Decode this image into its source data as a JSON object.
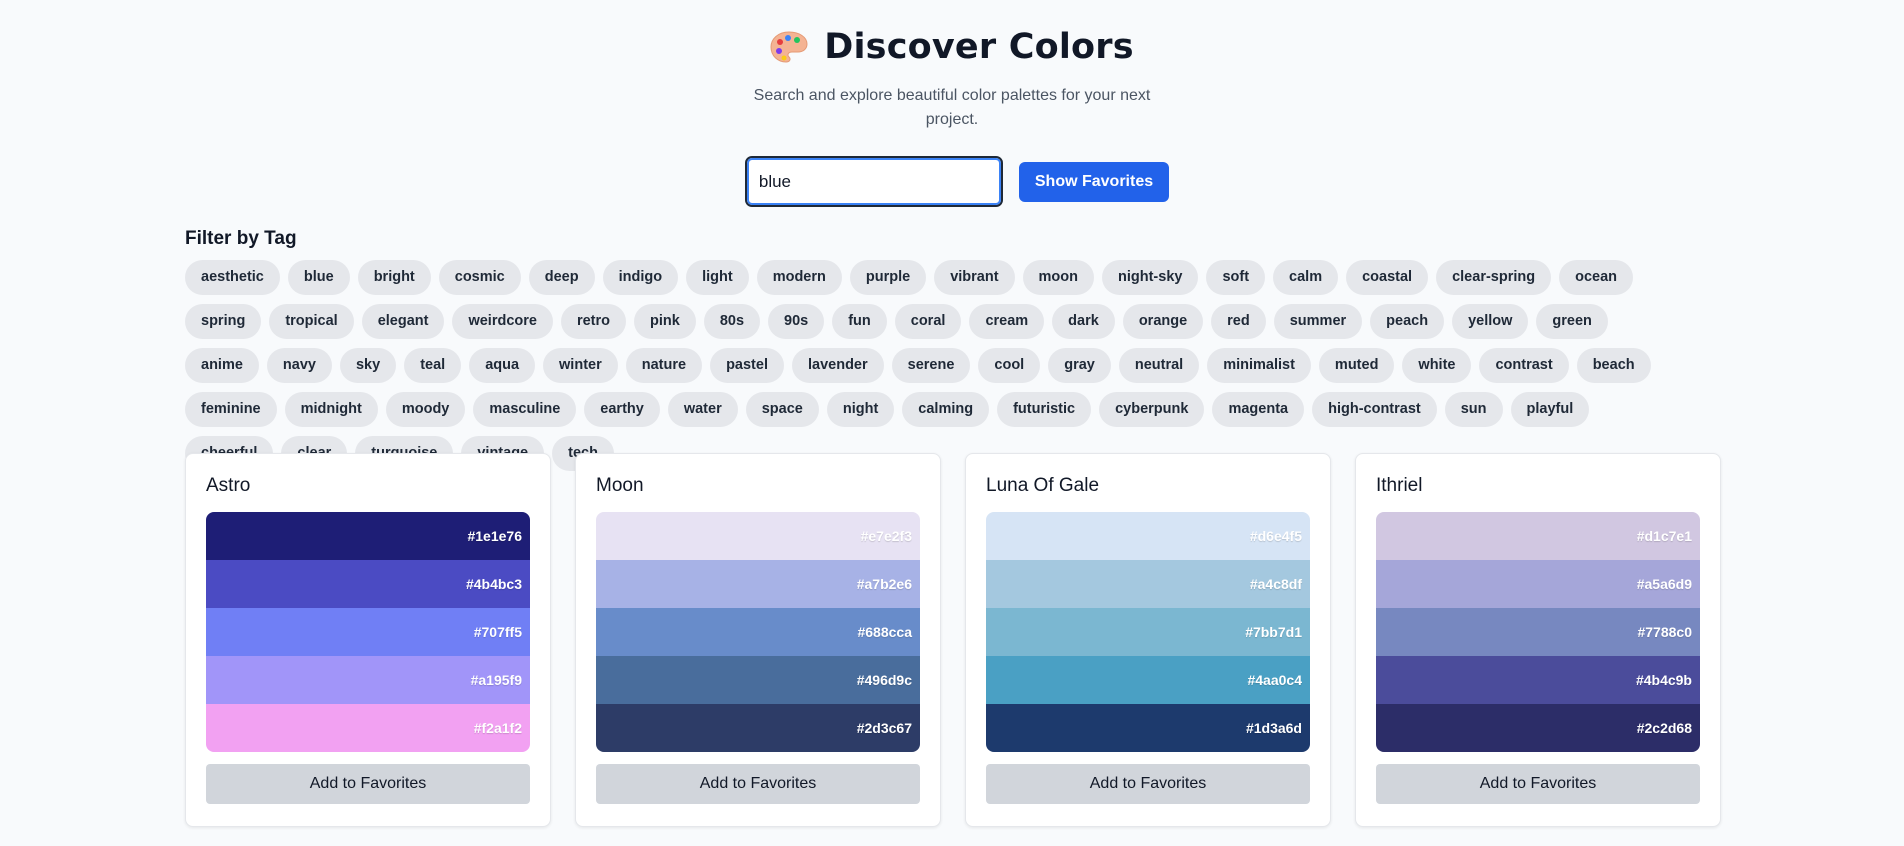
{
  "header": {
    "title": "Discover Colors",
    "subtitle": "Search and explore beautiful color palettes for your next project."
  },
  "search": {
    "value": "blue"
  },
  "favorites_button": "Show Favorites",
  "filter": {
    "title": "Filter by Tag",
    "tags": [
      "aesthetic",
      "blue",
      "bright",
      "cosmic",
      "deep",
      "indigo",
      "light",
      "modern",
      "purple",
      "vibrant",
      "moon",
      "night-sky",
      "soft",
      "calm",
      "coastal",
      "clear-spring",
      "ocean",
      "spring",
      "tropical",
      "elegant",
      "weirdcore",
      "retro",
      "pink",
      "80s",
      "90s",
      "fun",
      "coral",
      "cream",
      "dark",
      "orange",
      "red",
      "summer",
      "peach",
      "yellow",
      "green",
      "anime",
      "navy",
      "sky",
      "teal",
      "aqua",
      "winter",
      "nature",
      "pastel",
      "lavender",
      "serene",
      "cool",
      "gray",
      "neutral",
      "minimalist",
      "muted",
      "white",
      "contrast",
      "beach",
      "feminine",
      "midnight",
      "moody",
      "masculine",
      "earthy",
      "water",
      "space",
      "night",
      "calming",
      "futuristic",
      "cyberpunk",
      "magenta",
      "high-contrast",
      "sun",
      "playful",
      "cheerful",
      "clear",
      "turquoise",
      "vintage",
      "tech"
    ]
  },
  "add_button_label": "Add to Favorites",
  "palettes": [
    {
      "name": "Astro",
      "colors": [
        "#1e1e76",
        "#4b4bc3",
        "#707ff5",
        "#a195f9",
        "#f2a1f2"
      ]
    },
    {
      "name": "Moon",
      "colors": [
        "#e7e2f3",
        "#a7b2e6",
        "#688cca",
        "#496d9c",
        "#2d3c67"
      ]
    },
    {
      "name": "Luna Of Gale",
      "colors": [
        "#d6e4f5",
        "#a4c8df",
        "#7bb7d1",
        "#4aa0c4",
        "#1d3a6d"
      ]
    },
    {
      "name": "Ithriel",
      "colors": [
        "#d1c7e1",
        "#a5a6d9",
        "#7788c0",
        "#4b4c9b",
        "#2c2d68"
      ]
    }
  ]
}
